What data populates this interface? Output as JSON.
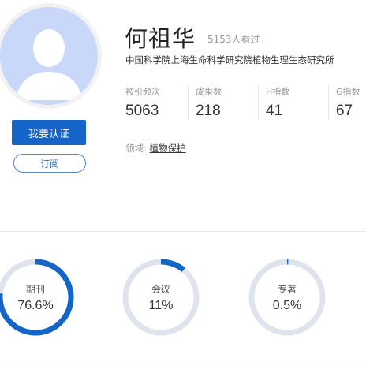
{
  "profile": {
    "name": "何祖华",
    "views": "5153人看过",
    "organization": "中国科学院上海生命科学研究院植物生理生态研究所",
    "verify_label": "我要认证",
    "subscribe_label": "订阅",
    "avatar_icon": "default-user-avatar-icon",
    "avatar_color": "#c9d8f8",
    "accent_color": "#1565c8"
  },
  "stats": [
    {
      "label": "被引频次",
      "value": "5063"
    },
    {
      "label": "成果数",
      "value": "218"
    },
    {
      "label": "H指数",
      "value": "41"
    },
    {
      "label": "G指数",
      "value": "67"
    }
  ],
  "field": {
    "label": "领域:",
    "value": "植物保护"
  },
  "distribution": [
    {
      "label": "期刊",
      "percent_text": "76.6%",
      "fraction": 0.766,
      "color": "#1565c8"
    },
    {
      "label": "会议",
      "percent_text": "11%",
      "fraction": 0.11,
      "color": "#1565c8"
    },
    {
      "label": "专著",
      "percent_text": "0.5%",
      "fraction": 0.005,
      "color": "#1565c8"
    }
  ]
}
